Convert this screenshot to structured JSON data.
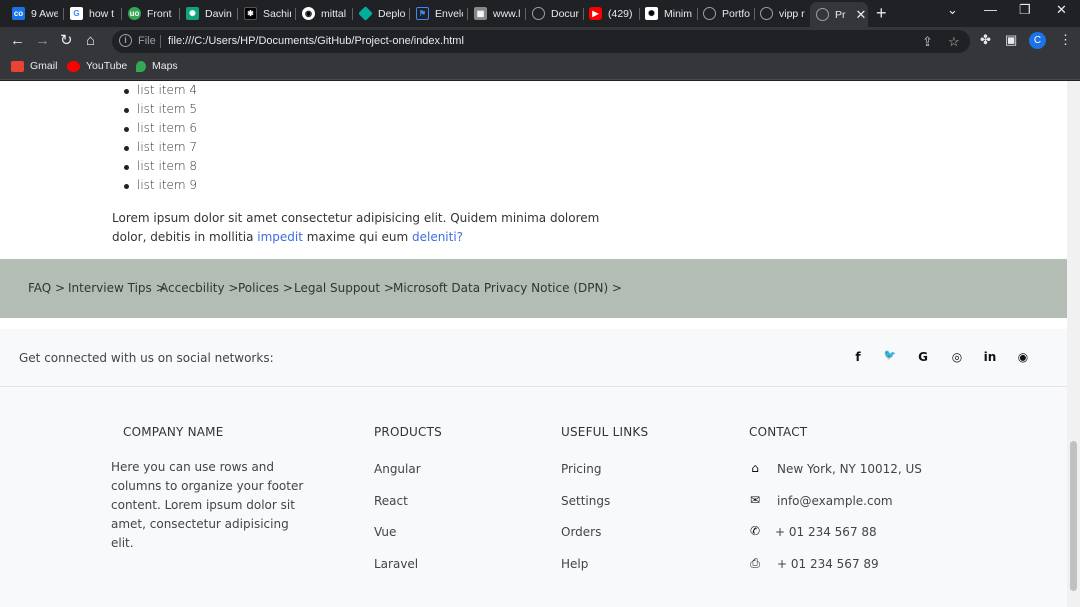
{
  "browser": {
    "tabs": [
      {
        "title": "9 Awe",
        "icon": "co-icon",
        "color": "#1a73e8"
      },
      {
        "title": "how t",
        "icon": "google-icon",
        "color": "#ffffff"
      },
      {
        "title": "Front",
        "icon": "uo-icon",
        "color": "#34a853"
      },
      {
        "title": "Davin",
        "icon": "chatgpt-icon",
        "color": "#10a37f"
      },
      {
        "title": "Sachir",
        "icon": "dev-icon",
        "color": "#000000"
      },
      {
        "title": "mittal",
        "icon": "github-icon",
        "color": "#ffffff"
      },
      {
        "title": "Deplo",
        "icon": "netlify-icon",
        "color": "#00ad9f"
      },
      {
        "title": "Envelo",
        "icon": "flag-icon",
        "color": "#4285f4"
      },
      {
        "title": "www.l",
        "icon": "linkedin-icon",
        "color": "#888888"
      },
      {
        "title": "Docur",
        "icon": "globe-icon",
        "color": "#9aa0a6"
      },
      {
        "title": "(429)",
        "icon": "youtube-icon",
        "color": "#ff0000"
      },
      {
        "title": "Minim",
        "icon": "chatgpt-icon",
        "color": "#ffffff"
      },
      {
        "title": "Portfo",
        "icon": "globe-icon",
        "color": "#9aa0a6"
      },
      {
        "title": "vipp r",
        "icon": "globe-icon",
        "color": "#9aa0a6"
      },
      {
        "title": "Pr",
        "icon": "globe-icon",
        "color": "#9aa0a6"
      }
    ],
    "omnibox": {
      "scheme": "File",
      "url": "file:///C:/Users/HP/Documents/GitHub/Project-one/index.html"
    },
    "profile_initial": "C",
    "bookmarks": [
      {
        "label": "Gmail",
        "icon": "gmail-icon",
        "color": "#ea4335"
      },
      {
        "label": "YouTube",
        "icon": "youtube-icon",
        "color": "#ff0000"
      },
      {
        "label": "Maps",
        "icon": "maps-icon",
        "color": "#34a853"
      }
    ]
  },
  "page": {
    "list_items": [
      "list item 4",
      "list item 5",
      "list item 6",
      "list item 7",
      "list item 8",
      "list item 9"
    ],
    "lorem": {
      "text1": "Lorem ipsum dolor sit amet consectetur adipisicing elit. Quidem minima dolorem dolor, debitis in mollitia ",
      "link1": "impedit",
      "text2": " maxime qui eum ",
      "link2": "deleniti?"
    },
    "crumbs": [
      "FAQ >",
      "Interview Tips >",
      "Accecbility >",
      "Polices >",
      "Legal Suppout >",
      "Microsoft Data Privacy Notice (DPN) >"
    ]
  },
  "footer": {
    "social_text": "Get connected with us on social networks:",
    "social_icons": [
      {
        "name": "facebook-icon",
        "glyph": "f"
      },
      {
        "name": "twitter-icon",
        "glyph": "🐦"
      },
      {
        "name": "google-icon",
        "glyph": "G"
      },
      {
        "name": "instagram-icon",
        "glyph": "◎"
      },
      {
        "name": "linkedin-icon",
        "glyph": "in"
      },
      {
        "name": "github-icon",
        "glyph": "◉"
      }
    ],
    "company": {
      "heading": "COMPANY NAME",
      "description": "Here you can use rows and columns to organize your footer content. Lorem ipsum dolor sit amet, consectetur adipisicing elit."
    },
    "products": {
      "heading": "PRODUCTS",
      "links": [
        "Angular",
        "React",
        "Vue",
        "Laravel"
      ]
    },
    "useful": {
      "heading": "USEFUL LINKS",
      "links": [
        "Pricing",
        "Settings",
        "Orders",
        "Help"
      ]
    },
    "contact": {
      "heading": "CONTACT",
      "items": [
        {
          "icon": "home-icon",
          "glyph": "⌂",
          "text": "New York, NY 10012, US"
        },
        {
          "icon": "envelope-icon",
          "glyph": "✉",
          "text": "info@example.com"
        },
        {
          "icon": "phone-icon",
          "glyph": "✆",
          "text": "+ 01 234 567 88"
        },
        {
          "icon": "print-icon",
          "glyph": "⎙",
          "text": "+ 01 234 567 89"
        }
      ]
    }
  }
}
